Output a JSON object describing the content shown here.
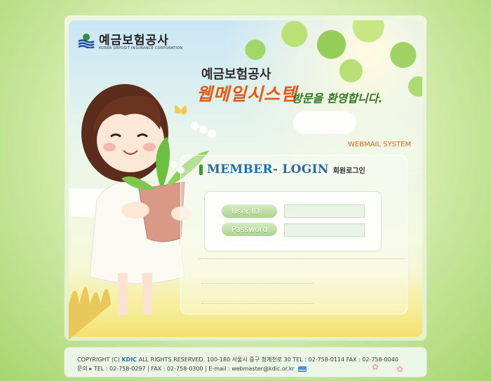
{
  "brand": {
    "name_ko": "예금보험공사",
    "name_en": "KOREA DEPOSIT INSURANCE CORPORATION"
  },
  "hero": {
    "line1": "예금보험공사",
    "line2": "웹메일시스템",
    "line3": "방문을 환영합니다.",
    "tag": "WEBMAIL SYSTEM"
  },
  "login": {
    "title_en": "MEMBER- LOGIN",
    "title_ko": "회원로그인",
    "user_label": "User ID",
    "password_label": "Password",
    "user_value": "",
    "password_value": ""
  },
  "footer": {
    "line1_prefix": "COPYRIGHT (C)",
    "line1_brand": "KDIC",
    "line1_rest": "ALL RIGHTS RESERVED.  100-180 서울시 중구 청계천로 30  TEL : 02-758-0114  FAX : 02-758-0040",
    "line2": "문의 ▸ TEL : 02-758-0297  |  FAX : 02-758-0300  |  E-mail : webmaster@kdic.or.kr"
  },
  "colors": {
    "accent_green": "#3b9b2c",
    "title_blue": "#2b6a9a",
    "orange": "#e35a12"
  }
}
